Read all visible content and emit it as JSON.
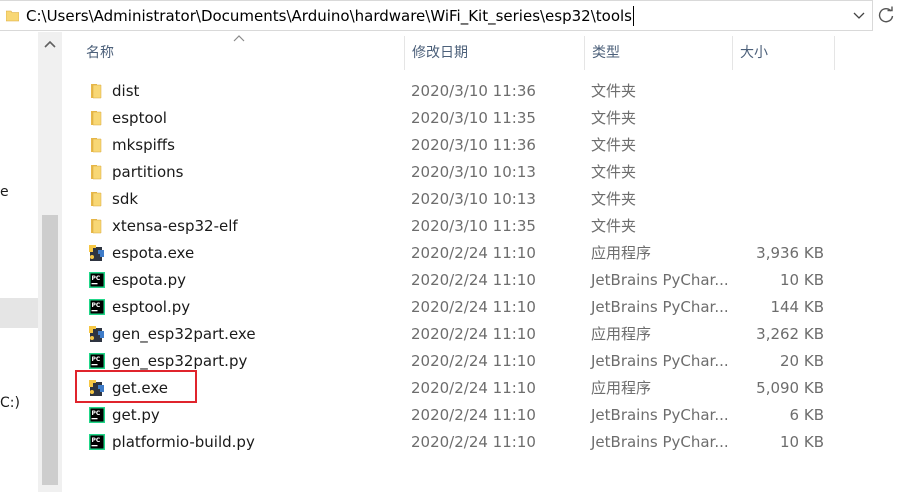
{
  "address_bar": {
    "path": "C:\\Users\\Administrator\\Documents\\Arduino\\hardware\\WiFi_Kit_series\\esp32\\tools"
  },
  "nav_pane": {
    "fragments": [
      "e",
      "C:)"
    ]
  },
  "columns": {
    "name": "名称",
    "date": "修改日期",
    "type": "类型",
    "size": "大小"
  },
  "files": [
    {
      "name": "dist",
      "date": "2020/3/10 11:36",
      "type": "文件夹",
      "size": "",
      "icon": "folder-icon"
    },
    {
      "name": "esptool",
      "date": "2020/3/10 11:35",
      "type": "文件夹",
      "size": "",
      "icon": "folder-icon"
    },
    {
      "name": "mkspiffs",
      "date": "2020/3/10 11:36",
      "type": "文件夹",
      "size": "",
      "icon": "folder-icon"
    },
    {
      "name": "partitions",
      "date": "2020/3/10 10:13",
      "type": "文件夹",
      "size": "",
      "icon": "folder-icon"
    },
    {
      "name": "sdk",
      "date": "2020/3/10 10:13",
      "type": "文件夹",
      "size": "",
      "icon": "folder-icon"
    },
    {
      "name": "xtensa-esp32-elf",
      "date": "2020/3/10 11:35",
      "type": "文件夹",
      "size": "",
      "icon": "folder-icon"
    },
    {
      "name": "espota.exe",
      "date": "2020/2/24 11:10",
      "type": "应用程序",
      "size": "3,936 KB",
      "icon": "python-exe-icon"
    },
    {
      "name": "espota.py",
      "date": "2020/2/24 11:10",
      "type": "JetBrains PyChar...",
      "size": "10 KB",
      "icon": "pycharm-file-icon"
    },
    {
      "name": "esptool.py",
      "date": "2020/2/24 11:10",
      "type": "JetBrains PyChar...",
      "size": "144 KB",
      "icon": "pycharm-file-icon"
    },
    {
      "name": "gen_esp32part.exe",
      "date": "2020/2/24 11:10",
      "type": "应用程序",
      "size": "3,262 KB",
      "icon": "python-exe-icon"
    },
    {
      "name": "gen_esp32part.py",
      "date": "2020/2/24 11:10",
      "type": "JetBrains PyChar...",
      "size": "20 KB",
      "icon": "pycharm-file-icon"
    },
    {
      "name": "get.exe",
      "date": "2020/2/24 11:10",
      "type": "应用程序",
      "size": "5,090 KB",
      "icon": "python-exe-icon"
    },
    {
      "name": "get.py",
      "date": "2020/2/24 11:10",
      "type": "JetBrains PyChar...",
      "size": "6 KB",
      "icon": "pycharm-file-icon"
    },
    {
      "name": "platformio-build.py",
      "date": "2020/2/24 11:10",
      "type": "JetBrains PyChar...",
      "size": "10 KB",
      "icon": "pycharm-file-icon"
    }
  ],
  "colors": {
    "highlight": "#e0242c",
    "folder": "#f8d775",
    "header_text": "#4c607a"
  }
}
